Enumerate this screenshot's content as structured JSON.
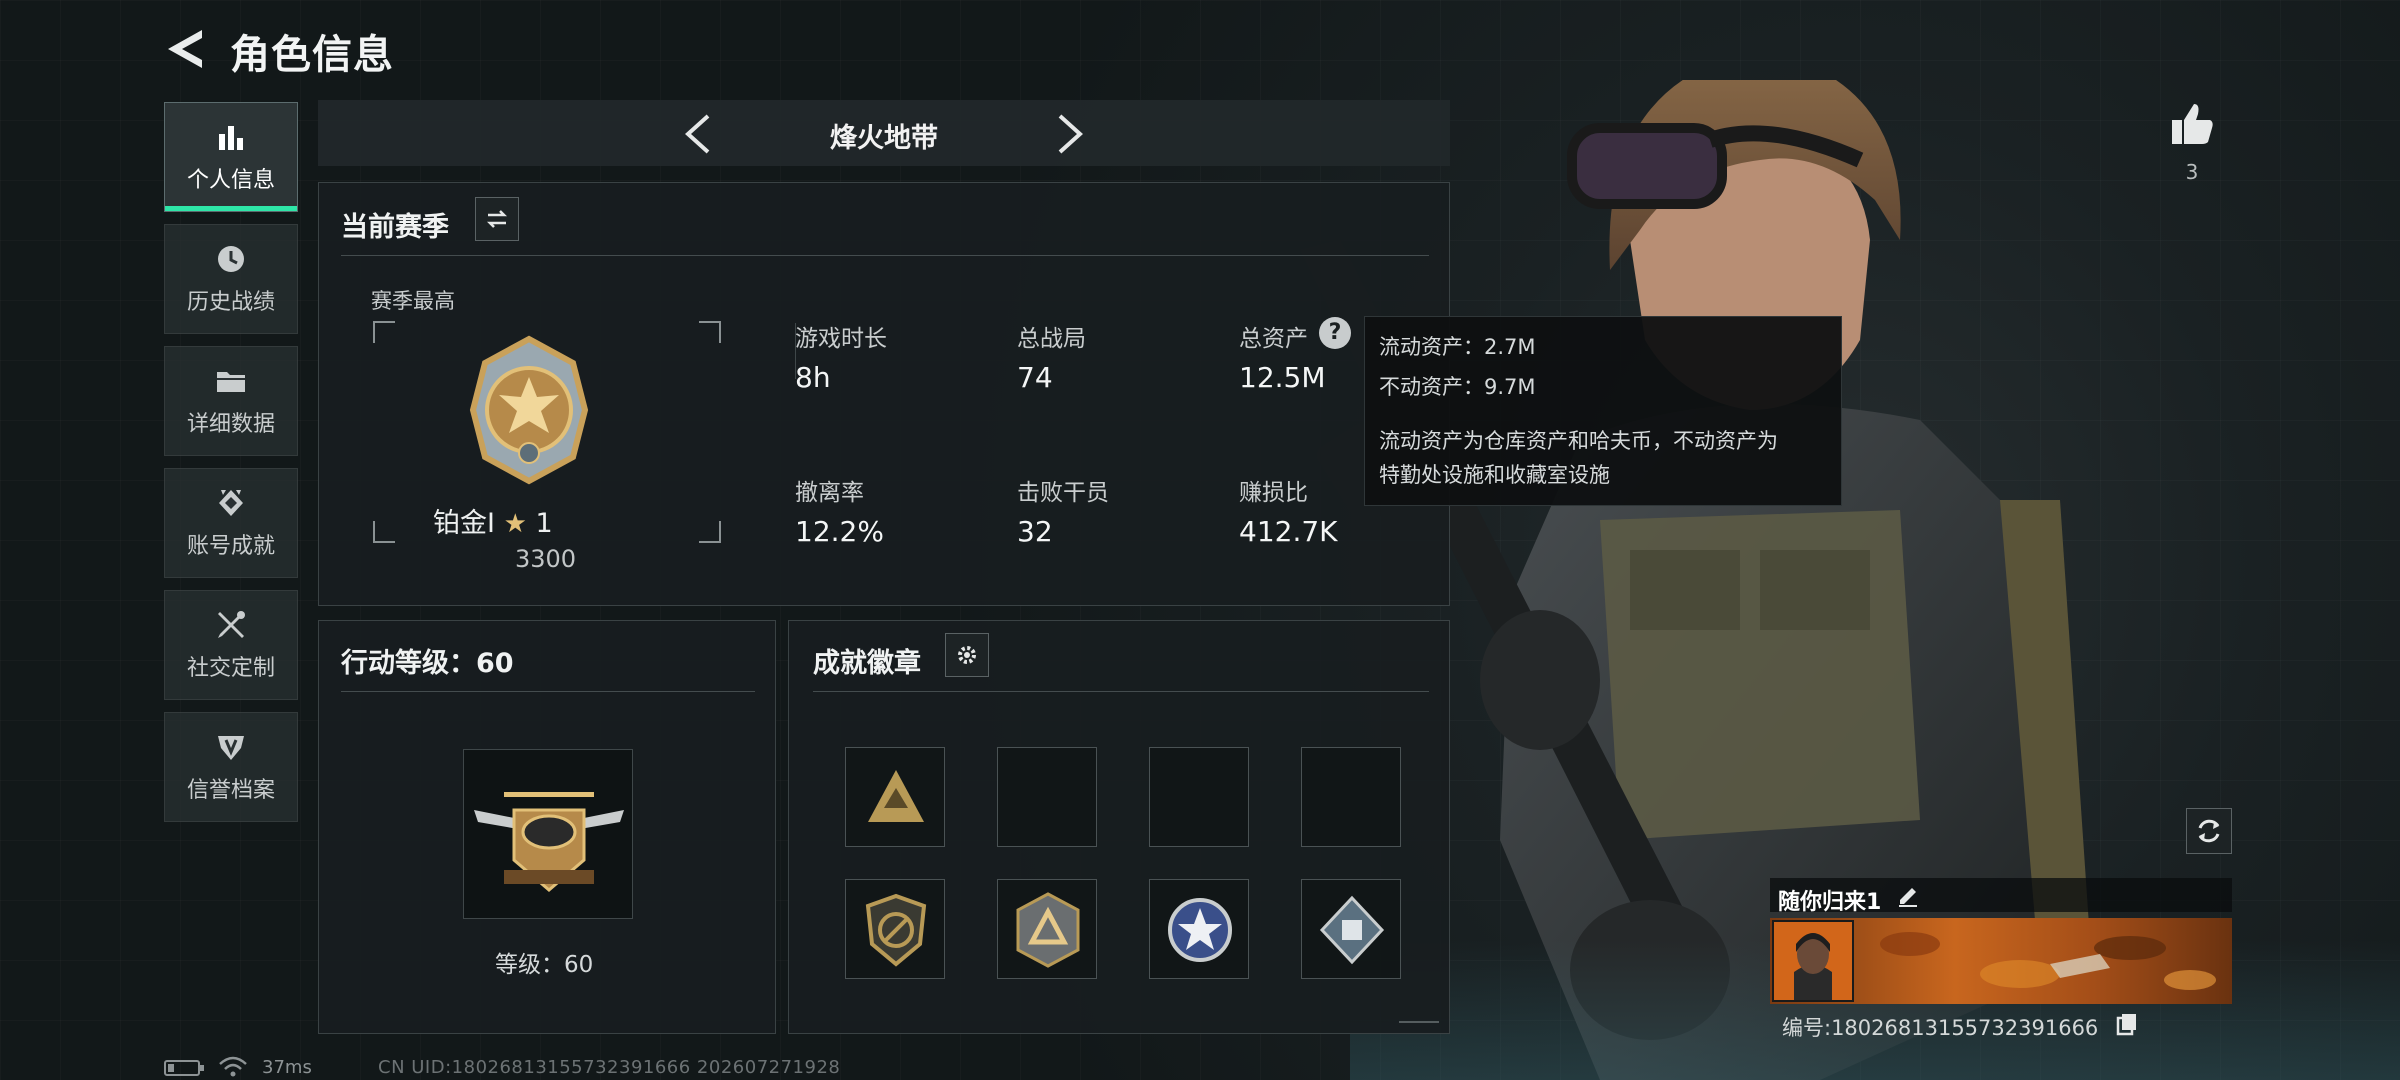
{
  "header": {
    "title": "角色信息"
  },
  "sidebar": {
    "items": [
      {
        "label": "个人信息",
        "icon": "bar-chart-icon",
        "active": true
      },
      {
        "label": "历史战绩",
        "icon": "clock-icon"
      },
      {
        "label": "详细数据",
        "icon": "folder-icon"
      },
      {
        "label": "账号成就",
        "icon": "achievement-icon"
      },
      {
        "label": "社交定制",
        "icon": "tools-icon"
      },
      {
        "label": "信誉档案",
        "icon": "shield-icon"
      }
    ]
  },
  "mode": {
    "title": "烽火地带"
  },
  "season": {
    "title": "当前赛季",
    "best_label": "赛季最高",
    "rank_name": "铂金Ⅰ",
    "rank_stars": "1",
    "rank_score": "3300",
    "stats": [
      {
        "label": "游戏时长",
        "value": "8h"
      },
      {
        "label": "总战局",
        "value": "74"
      },
      {
        "label": "总资产",
        "value": "12.5M"
      },
      {
        "label": "撤离率",
        "value": "12.2%"
      },
      {
        "label": "击败干员",
        "value": "32"
      },
      {
        "label": "赚损比",
        "value": "412.7K"
      }
    ]
  },
  "tooltip": {
    "line1": "流动资产：2.7M",
    "line2": "不动资产：9.7M",
    "desc1": "流动资产为仓库资产和哈夫币，不动资产为",
    "desc2": "特勤处设施和收藏室设施"
  },
  "action_level": {
    "title": "行动等级：60",
    "level_text": "等级：60"
  },
  "badges": {
    "title": "成就徽章",
    "slots": [
      {
        "icon": "gold-triangle-badge-icon"
      },
      {
        "icon": ""
      },
      {
        "icon": ""
      },
      {
        "icon": ""
      },
      {
        "icon": "shield-circle-badge-icon"
      },
      {
        "icon": "triangle-emblem-badge-icon"
      },
      {
        "icon": "blue-star-badge-icon"
      },
      {
        "icon": "diamond-box-badge-icon"
      }
    ]
  },
  "player": {
    "name": "随你归来1",
    "id_text": "编号:18026813155732391666",
    "likes": "3"
  },
  "status_bar": {
    "ping": "37ms",
    "uid_text": "CN UID:18026813155732391666 202607271928"
  },
  "colors": {
    "accent": "#2ee6a8",
    "gold": "#c9a15a",
    "panel": "#181d1f"
  }
}
